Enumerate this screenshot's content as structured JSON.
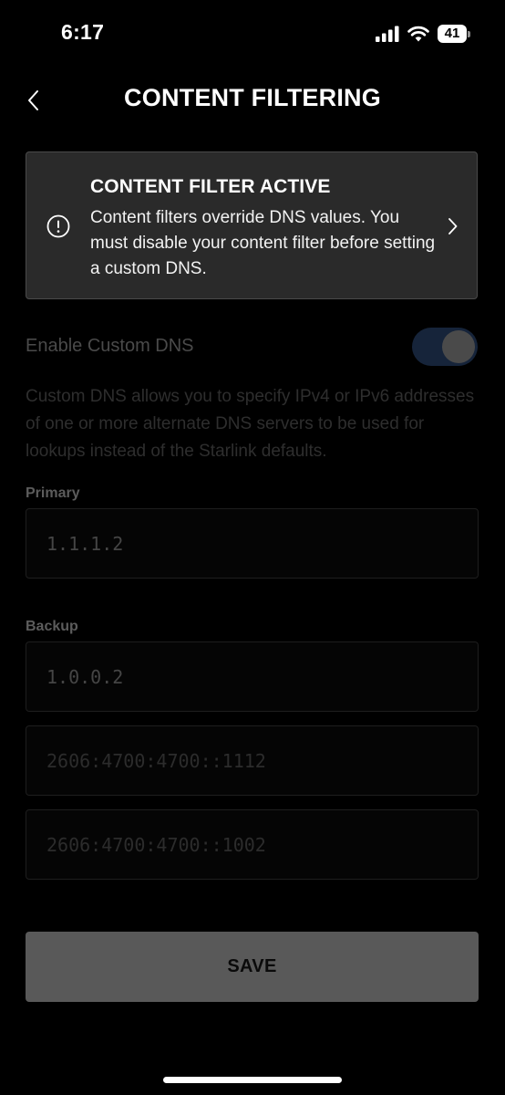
{
  "status_bar": {
    "time": "6:17",
    "battery_level": "41",
    "icons": [
      "signal-icon",
      "wifi-icon",
      "battery-icon"
    ]
  },
  "header": {
    "title": "CONTENT FILTERING",
    "back_icon": "chevron-left-icon"
  },
  "banner": {
    "icon": "info-circle-icon",
    "title": "CONTENT FILTER ACTIVE",
    "text": "Content filters override DNS values. You must disable your content filter before setting a custom DNS.",
    "chevron_icon": "chevron-right-icon"
  },
  "custom_dns": {
    "label": "Enable Custom DNS",
    "enabled": true,
    "description": "Custom DNS allows you to specify IPv4 or IPv6 addresses of one or more alternate DNS servers to be used for lookups instead of the Starlink defaults."
  },
  "primary": {
    "label": "Primary",
    "value": "1.1.1.2"
  },
  "backup": {
    "label": "Backup",
    "fields": [
      {
        "value": "1.0.0.2"
      },
      {
        "placeholder": "2606:4700:4700::1112"
      },
      {
        "placeholder": "2606:4700:4700::1002"
      }
    ]
  },
  "save_button": {
    "label": "SAVE"
  },
  "colors": {
    "background": "#000000",
    "banner_background": "#2a2a2a",
    "save_button": "#595959",
    "toggle_track": "#16243a"
  }
}
